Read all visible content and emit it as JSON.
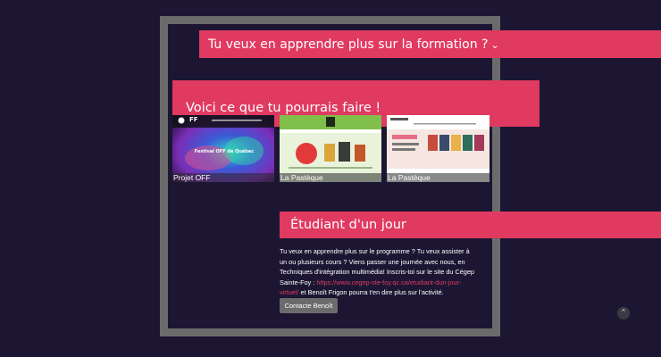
{
  "banners": {
    "formation": "Tu veux en apprendre plus sur la formation ?",
    "projects": "Voici ce que tu pourrais faire !",
    "student": "Étudiant d'un jour"
  },
  "icons": {
    "chevron": "chevron-down-icon",
    "scroll_top": "chevron-up-icon"
  },
  "projects": [
    {
      "caption": "Projet OFF",
      "site_logo": "FF",
      "site_text": "Festival OFF de Québec"
    },
    {
      "caption": "La Pastèque",
      "site_logo": "",
      "site_text": ""
    },
    {
      "caption": "La Pastèque",
      "site_logo": "",
      "site_text": ""
    }
  ],
  "student": {
    "text_before": "Tu veux en apprendre plus sur le programme ? Tu veux assister à un ou plusieurs cours ? Viens passer une journée avec nous, en Techniques d'intégration multimédia! Inscris-toi sur le site du Cégep Sainte-Foy : ",
    "link": "https://www.cegep-ste-foy.qc.ca/etudiant-dun-jour-virtuel/",
    "text_after": " et Benoît Frigon pourra t'en dire plus sur l'activité.",
    "button": "Contacte Benoît"
  },
  "colors": {
    "background": "#1c1633",
    "accent": "#e03a61",
    "frame": "#6b6b6b"
  }
}
